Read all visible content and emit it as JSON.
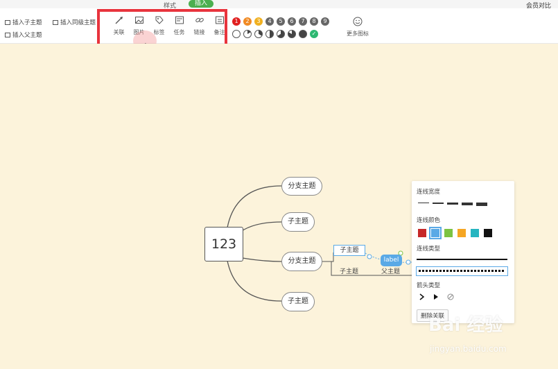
{
  "tabs": {
    "style": "样式",
    "insert": "插入"
  },
  "top_right_link": "会员对比",
  "toolbar_left": {
    "insert_child": "插入子主题",
    "insert_sibling": "插入同级主题",
    "insert_parent": "插入父主题"
  },
  "tools": [
    {
      "label": "关联",
      "icon": "link-arrow-icon"
    },
    {
      "label": "图片",
      "icon": "image-icon"
    },
    {
      "label": "标签",
      "icon": "tag-icon"
    },
    {
      "label": "任务",
      "icon": "task-icon"
    },
    {
      "label": "链接",
      "icon": "chain-icon"
    },
    {
      "label": "备注",
      "icon": "note-icon"
    }
  ],
  "priority_numbers": [
    "1",
    "2",
    "3",
    "4",
    "5",
    "6",
    "7",
    "8",
    "9"
  ],
  "priority_colors": [
    "#e02020",
    "#f08a24",
    "#f0b020",
    "#666",
    "#666",
    "#666",
    "#666",
    "#666",
    "#666"
  ],
  "progress_icons": [
    "progress-0",
    "progress-1",
    "progress-2",
    "progress-3",
    "progress-4",
    "progress-5",
    "progress-6",
    "progress-done"
  ],
  "more_icons": "更多图标",
  "map": {
    "root": "123",
    "branches": [
      "分支主题",
      "子主题",
      "分支主题",
      "子主题"
    ],
    "sub_selected": "子主题",
    "sub_plain": "子主题",
    "label_tag": "label",
    "parent_node": "父主题"
  },
  "panel": {
    "line_width_title": "连线宽度",
    "line_color_title": "连线颜色",
    "line_colors": [
      "#c62828",
      "#5aa9e6",
      "#7cc342",
      "#f5a623",
      "#26b5c0",
      "#111111"
    ],
    "line_type_title": "连线类型",
    "arrow_type_title": "箭头类型",
    "delete_button": "删除关联"
  },
  "watermark": {
    "text": "Bai 经验",
    "url": "jingyan.baidu.com"
  }
}
